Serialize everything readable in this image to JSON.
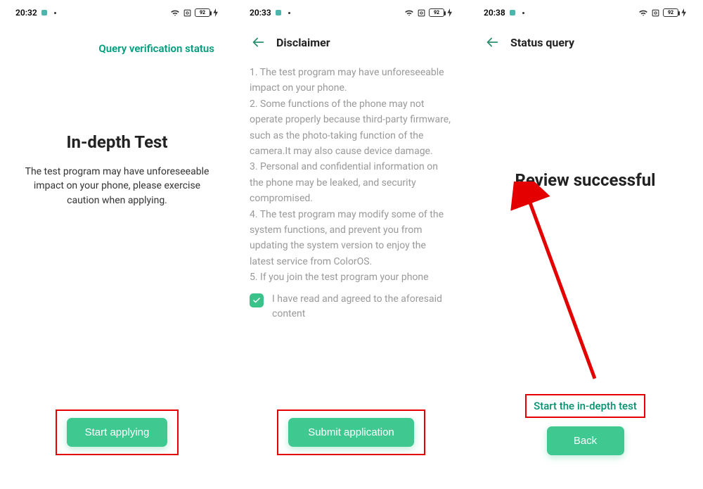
{
  "screen1": {
    "time": "20:32",
    "top_link": "Query verification status",
    "title": "In-depth Test",
    "subtitle": "The test program may have unforeseeable impact on your phone, please exercise caution when applying.",
    "button": "Start applying",
    "battery": "92"
  },
  "screen2": {
    "time": "20:33",
    "header": "Disclaimer",
    "body": "1. The test program may have unforeseeable impact on your phone.\n2. Some functions of the phone may not operate properly because third-party firmware, such as the photo-taking function of the camera.It may also cause device damage.\n3. Personal and confidential information on the phone may be leaked, and security compromised.\n4. The test program may modify some of the system functions, and prevent you from updating the system version to enjoy the latest service from ColorOS.\n5. If you join the test program your phone",
    "check_label": "I have read and agreed to the aforesaid content",
    "button": "Submit application",
    "battery": "92"
  },
  "screen3": {
    "time": "20:38",
    "header": "Status query",
    "title": "Review successful",
    "link": "Start the in-depth test",
    "button": "Back",
    "battery": "92"
  }
}
